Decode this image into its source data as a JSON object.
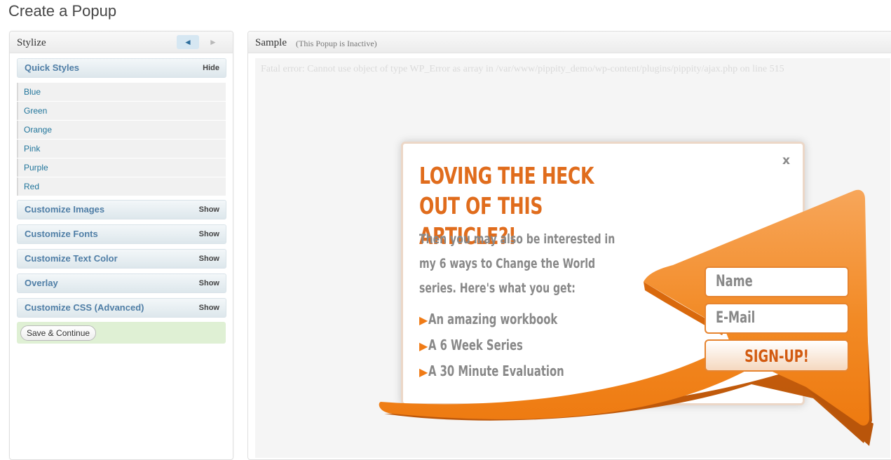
{
  "page": {
    "title": "Create a Popup"
  },
  "stylize": {
    "title": "Stylize",
    "prev_icon": "◄",
    "next_icon": "►",
    "quick_styles": {
      "label": "Quick Styles",
      "toggle": "Hide"
    },
    "styles": [
      "Blue",
      "Green",
      "Orange",
      "Pink",
      "Purple",
      "Red"
    ],
    "sections": [
      {
        "label": "Customize Images",
        "toggle": "Show"
      },
      {
        "label": "Customize Fonts",
        "toggle": "Show"
      },
      {
        "label": "Customize Text Color",
        "toggle": "Show"
      },
      {
        "label": "Overlay",
        "toggle": "Show"
      },
      {
        "label": "Customize CSS (Advanced)",
        "toggle": "Show"
      }
    ],
    "save_label": "Save & Continue"
  },
  "sample": {
    "title": "Sample",
    "status": "(This Popup is Inactive)",
    "error": "Fatal error: Cannot use object of type WP_Error as array in /var/www/pippity_demo/wp-content/plugins/pippity/ajax.php on line 515"
  },
  "popup": {
    "close": "x",
    "heading": "LOVING THE HECK OUT OF THIS ARTICLE?!",
    "intro": "Then you may also be interested in my 6 ways to Change the World series. Here's what you get:",
    "bullets": [
      "An amazing workbook",
      "A 6 Week Series",
      "A 30 Minute Evaluation"
    ],
    "form": {
      "name": "Name",
      "email": "E-Mail",
      "button": "SIGN-UP!"
    },
    "colors": {
      "accent": "#e06c1c",
      "arrow": "#f28a25",
      "text": "#888888"
    }
  }
}
